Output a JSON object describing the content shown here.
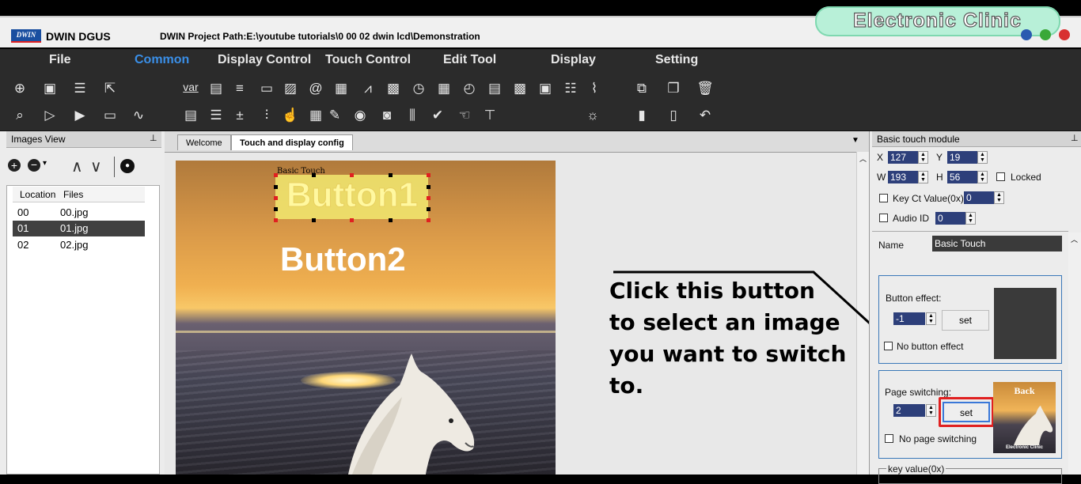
{
  "app": {
    "name": "DWIN DGUS",
    "logo_text": "DWIN",
    "project_path": "DWIN Project Path:E:\\youtube tutorials\\0 00 02 dwin lcd\\Demonstration",
    "brand_watermark": "Electronic Clinic"
  },
  "menu": {
    "items": [
      "File",
      "Common",
      "Display Control",
      "Touch Control",
      "Edit Tool",
      "Display",
      "Setting"
    ],
    "active": "Common"
  },
  "images_view": {
    "title": "Images View",
    "columns": [
      "Location",
      "Files"
    ],
    "rows": [
      {
        "location": "00",
        "file": "00.jpg"
      },
      {
        "location": "01",
        "file": "01.jpg"
      },
      {
        "location": "02",
        "file": "02.jpg"
      }
    ],
    "selected_row": 1
  },
  "tabs": {
    "items": [
      "Welcome",
      "Touch and display config"
    ],
    "active": "Touch and display config"
  },
  "canvas": {
    "basic_touch_label": "Basic Touch",
    "button1_text": "Button1",
    "button2_text": "Button2"
  },
  "annotation": {
    "text_lines": [
      "Click this button",
      "to select an image",
      "you want to switch",
      "to."
    ]
  },
  "properties": {
    "title": "Basic touch module",
    "x_label": "X",
    "x_value": "127",
    "y_label": "Y",
    "y_value": "19",
    "w_label": "W",
    "w_value": "193",
    "h_label": "H",
    "h_value": "56",
    "locked_label": "Locked",
    "key_ct_label": "Key Ct Value(0x)",
    "key_ct_value": "0",
    "audio_id_label": "Audio ID",
    "audio_id_value": "0",
    "name_label": "Name",
    "name_value": "Basic Touch",
    "button_effect_label": "Button effect:",
    "button_effect_value": "-1",
    "set_label": "set",
    "no_button_effect_label": "No button effect",
    "page_switching_label": "Page switching:",
    "page_switching_value": "2",
    "no_page_switching_label": "No page switching",
    "key_value_label": "key value(0x)",
    "thumb_title": "Back",
    "thumb_caption": "Electronic Clinic"
  },
  "colors": {
    "highlight_red": "#e02020",
    "active_menu": "#3a8fe8",
    "group_border": "#3a78b8"
  }
}
